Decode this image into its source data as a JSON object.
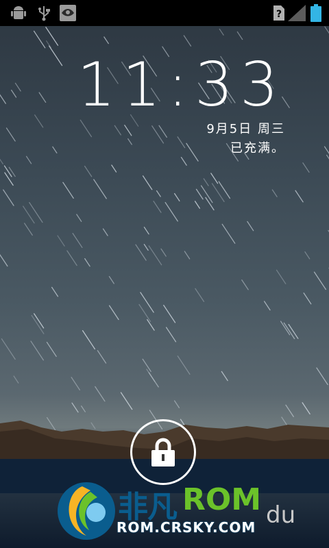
{
  "status_bar": {
    "left_icons": [
      "android-debug-icon",
      "usb-icon",
      "notification-app-icon"
    ],
    "right_icons": [
      "sim-unknown-icon",
      "signal-icon",
      "battery-icon"
    ],
    "colors": {
      "background": "#000000",
      "battery": "#33b5e5"
    }
  },
  "lockscreen": {
    "time": "11:33",
    "date": "9月5日 周三",
    "charging_status": "已充满。",
    "unlock_icon": "padlock-icon"
  },
  "watermark": {
    "brand": "非凡",
    "rom": "ROM",
    "url": "ROM.CRSKY.COM",
    "partial_text": "du"
  }
}
